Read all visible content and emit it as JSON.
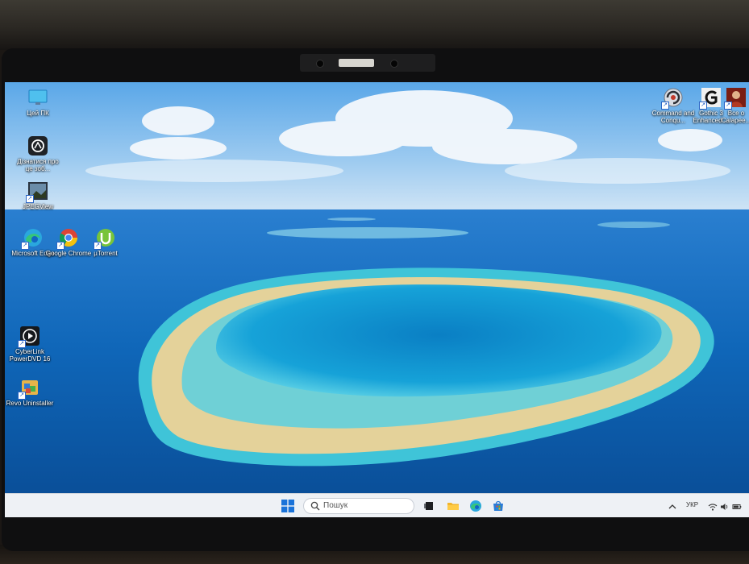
{
  "desktop": {
    "icons_left": [
      {
        "id": "this-pc",
        "label": "Цей ПК",
        "icon": "monitor-icon"
      },
      {
        "id": "diagnostics",
        "label": "Дізнатися про це зоб...",
        "icon": "camera-aperture-icon"
      },
      {
        "id": "jpegview",
        "label": "JPEGView",
        "icon": "image-viewer-icon"
      },
      {
        "id": "edge",
        "label": "Microsoft Edge",
        "icon": "edge-icon"
      },
      {
        "id": "chrome",
        "label": "Google Chrome",
        "icon": "chrome-icon"
      },
      {
        "id": "utorrent",
        "label": "µTorrent",
        "icon": "utorrent-icon"
      },
      {
        "id": "powerdvd",
        "label": "CyberLink PowerDVD 16",
        "icon": "play-icon"
      },
      {
        "id": "revo",
        "label": "Revo Uninstaller",
        "icon": "revo-uninstaller-icon"
      }
    ],
    "icons_right": [
      {
        "id": "cnc",
        "label": "Command and Conqu...",
        "icon": "command-and-conquer-icon"
      },
      {
        "id": "gothic",
        "label": "Gothic 3 Enhanced ...",
        "icon": "gothic-icon"
      },
      {
        "id": "saga",
        "label": "Все о Calapee...",
        "icon": "game-character-icon"
      }
    ]
  },
  "taskbar": {
    "search_placeholder": "Пошук",
    "language": "УКР",
    "pinned": [
      "task-view-icon",
      "file-explorer-icon",
      "edge-icon",
      "store-icon"
    ]
  },
  "colors": {
    "taskbar_bg": "#eef1f5",
    "windows_blue": "#1a73d9",
    "ocean_deep": "#0e5fae",
    "lagoon": "#1aa6d6",
    "sand": "#e4d29a"
  }
}
